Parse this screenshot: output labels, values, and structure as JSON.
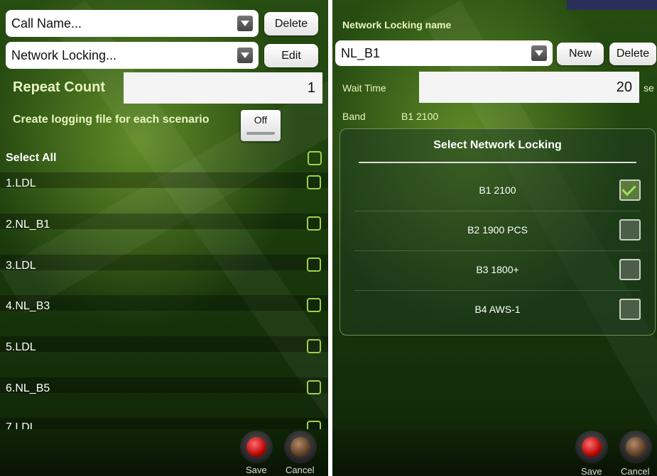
{
  "left": {
    "call_name": "Call Name...",
    "delete_label": "Delete",
    "network_locking": "Network Locking...",
    "edit_label": "Edit",
    "repeat_count_label": "Repeat Count",
    "repeat_count_value": "1",
    "logging_label": "Create logging file for each scenario",
    "toggle_label": "Off",
    "select_all_label": "Select All",
    "items": [
      "1.LDL",
      "2.NL_B1",
      "3.LDL",
      "4.NL_B3",
      "5.LDL",
      "6.NL_B5",
      "7.LDL"
    ],
    "save_label": "Save",
    "cancel_label": "Cancel"
  },
  "right": {
    "header": "Network Locking name",
    "name_value": "NL_B1",
    "new_label": "New",
    "delete_label": "Delete",
    "wait_time_label": "Wait Time",
    "wait_time_value": "20",
    "wait_unit": "se",
    "band_label": "Band",
    "band_value": "B1 2100",
    "dialog": {
      "title": "Select Network Locking",
      "options": [
        {
          "label": "B1 2100",
          "checked": true
        },
        {
          "label": "B2 1900 PCS",
          "checked": false
        },
        {
          "label": "B3 1800+",
          "checked": false
        },
        {
          "label": "B4 AWS-1",
          "checked": false
        }
      ]
    },
    "save_label": "Save",
    "cancel_label": "Cancel"
  },
  "colors": {
    "accent_green": "#9fd24a",
    "save_red": "#c00000",
    "cancel_brown": "#5a3a22"
  }
}
